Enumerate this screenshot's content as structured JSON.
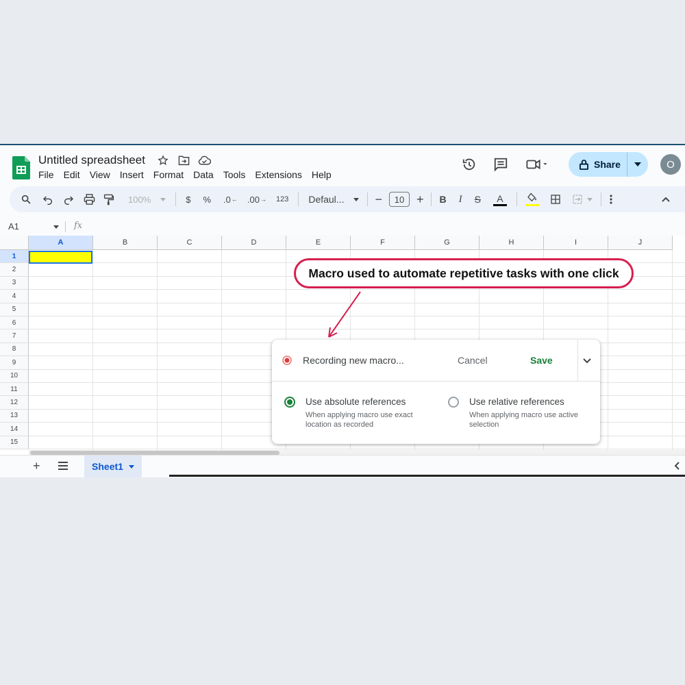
{
  "doc": {
    "title": "Untitled spreadsheet"
  },
  "menu": [
    "File",
    "Edit",
    "View",
    "Insert",
    "Format",
    "Data",
    "Tools",
    "Extensions",
    "Help"
  ],
  "share": {
    "label": "Share"
  },
  "avatar": {
    "initial": "O"
  },
  "toolbar": {
    "zoom": "100%",
    "currency": "$",
    "percent": "%",
    "dec_decrease": ".0",
    "dec_increase": ".00",
    "number_format": "123",
    "font": "Defaul...",
    "font_size": "10",
    "bold": "B",
    "italic": "I",
    "strike": "S",
    "text_color": "A"
  },
  "formula": {
    "cell_ref": "A1",
    "fx": "fx"
  },
  "grid": {
    "columns": [
      "A",
      "B",
      "C",
      "D",
      "E",
      "F",
      "G",
      "H",
      "I",
      "J"
    ],
    "rows": [
      "1",
      "2",
      "3",
      "4",
      "5",
      "6",
      "7",
      "8",
      "9",
      "10",
      "11",
      "12",
      "13",
      "14",
      "15"
    ],
    "selected_cell": "A1",
    "selected_fill": "#ffff00"
  },
  "sheets": {
    "tab": "Sheet1"
  },
  "macro": {
    "status": "Recording new macro...",
    "cancel": "Cancel",
    "save": "Save",
    "option1_title": "Use absolute references",
    "option1_desc": "When applying macro use exact location as recorded",
    "option1_selected": true,
    "option2_title": "Use relative references",
    "option2_desc": "When applying macro use active selection",
    "option2_selected": false
  },
  "callout": {
    "text": "Macro used to automate repetitive tasks with one click",
    "color": "#d61f4f"
  },
  "colors": {
    "accent_green": "#188038",
    "share_bg": "#c2e7ff",
    "selection_blue": "#1a73e8"
  }
}
